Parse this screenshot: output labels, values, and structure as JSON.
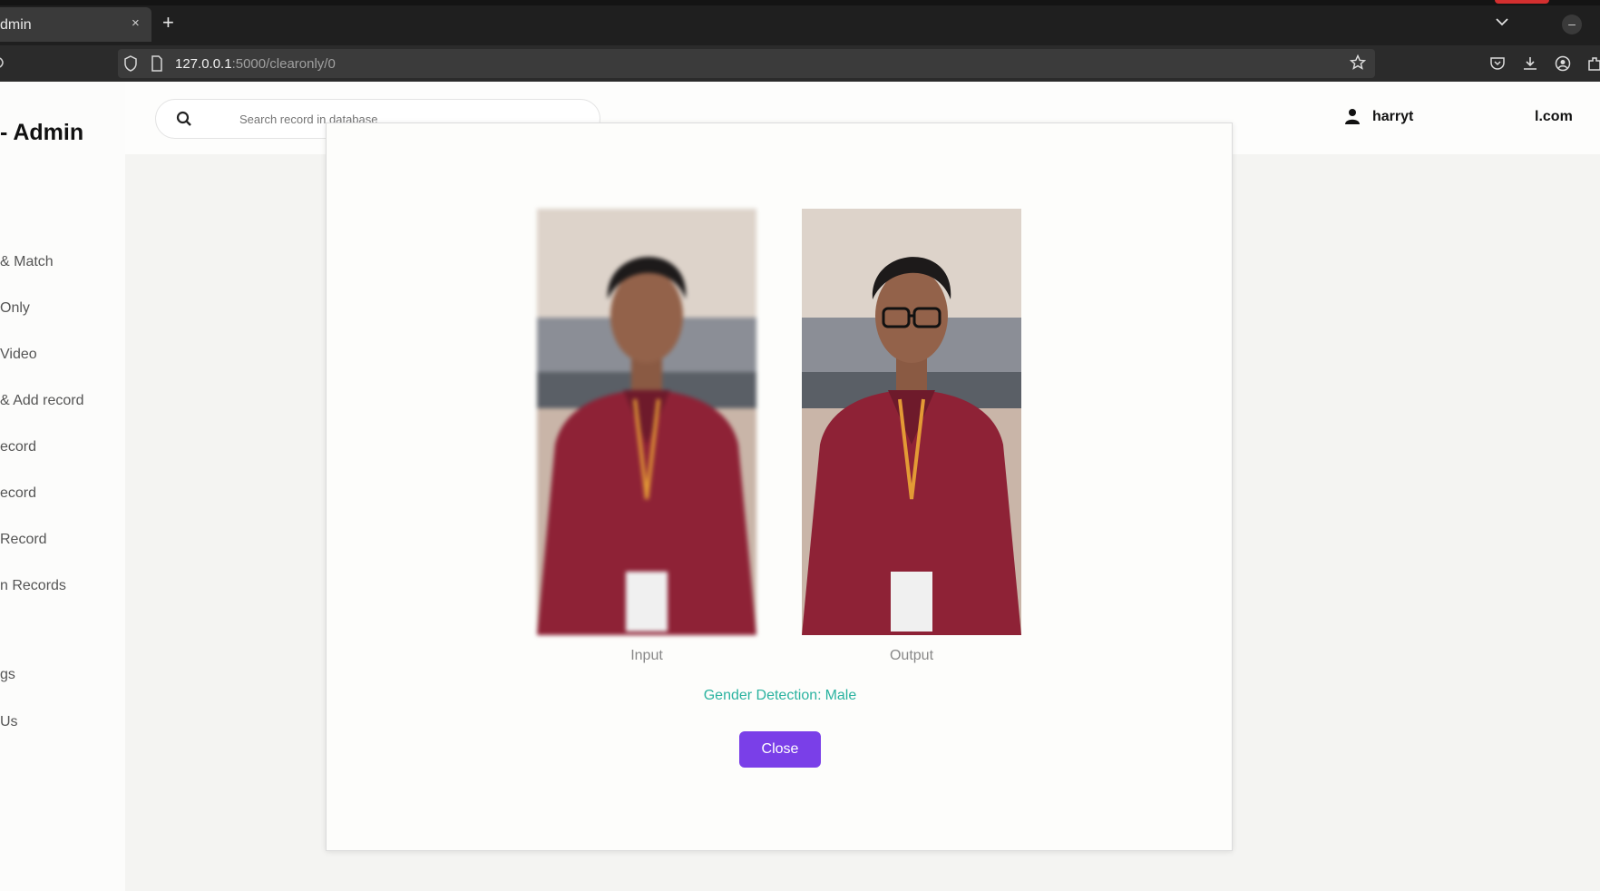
{
  "browser": {
    "tab_title": "dmin",
    "tab_close": "×",
    "new_tab": "+",
    "url_host": "127.0.0.1",
    "url_path": ":5000/clearonly/0"
  },
  "sidebar": {
    "brand": "- Admin",
    "items": [
      {
        "label": "& Match"
      },
      {
        "label": "Only"
      },
      {
        "label": "Video"
      },
      {
        "label": "& Add record"
      },
      {
        "label": "ecord"
      },
      {
        "label": "ecord"
      },
      {
        "label": "Record"
      },
      {
        "label": "n Records"
      },
      {
        "label": "gs"
      },
      {
        "label": "Us"
      }
    ]
  },
  "header": {
    "search_placeholder": "Search record in database",
    "username": "harryt",
    "email_fragment": "l.com"
  },
  "modal": {
    "input_caption": "Input",
    "output_caption": "Output",
    "result_label": "Gender Detection:",
    "result_value": "Male",
    "close_label": "Close"
  },
  "colors": {
    "accent": "#7a3fe8",
    "result_text": "#2bb3a0"
  }
}
